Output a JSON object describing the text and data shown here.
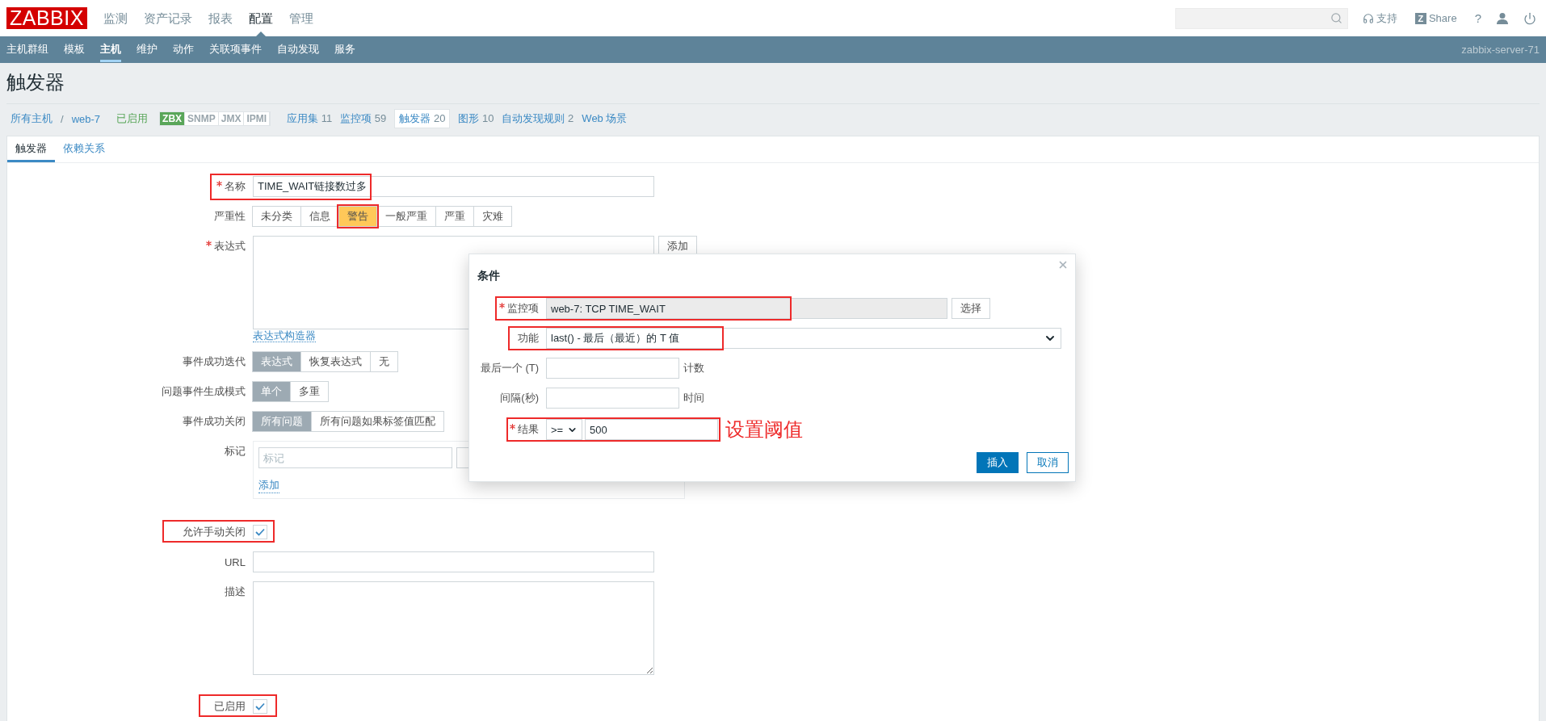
{
  "header": {
    "logo": "ZABBIX",
    "menu": [
      {
        "label": "监测",
        "selected": false
      },
      {
        "label": "资产记录",
        "selected": false
      },
      {
        "label": "报表",
        "selected": false
      },
      {
        "label": "配置",
        "selected": true
      },
      {
        "label": "管理",
        "selected": false
      }
    ],
    "support": "支持",
    "share_letter": "Z",
    "share": "Share",
    "help": "?"
  },
  "subnav": {
    "items": [
      {
        "label": "主机群组",
        "selected": false
      },
      {
        "label": "模板",
        "selected": false
      },
      {
        "label": "主机",
        "selected": true
      },
      {
        "label": "维护",
        "selected": false
      },
      {
        "label": "动作",
        "selected": false
      },
      {
        "label": "关联项事件",
        "selected": false
      },
      {
        "label": "自动发现",
        "selected": false
      },
      {
        "label": "服务",
        "selected": false
      }
    ],
    "server": "zabbix-server-71"
  },
  "page_title": "触发器",
  "breadcrumbs": {
    "items": [
      "所有主机",
      "web-7"
    ],
    "separator": "/",
    "status": "已启用",
    "interfaces": [
      {
        "label": "ZBX",
        "active": true
      },
      {
        "label": "SNMP",
        "active": false
      },
      {
        "label": "JMX",
        "active": false
      },
      {
        "label": "IPMI",
        "active": false
      }
    ],
    "links": [
      {
        "label": "应用集",
        "count": "11",
        "selected": false
      },
      {
        "label": "监控项",
        "count": "59",
        "selected": false
      },
      {
        "label": "触发器",
        "count": "20",
        "selected": true
      },
      {
        "label": "图形",
        "count": "10",
        "selected": false
      },
      {
        "label": "自动发现规则",
        "count": "2",
        "selected": false
      },
      {
        "label": "Web 场景",
        "selected": false
      }
    ]
  },
  "tabs": [
    {
      "label": "触发器",
      "selected": true
    },
    {
      "label": "依赖关系",
      "selected": false
    }
  ],
  "form": {
    "name": {
      "label": "名称",
      "required": true,
      "value": "TIME_WAIT链接数过多",
      "highlighted": true
    },
    "severity": {
      "label": "严重性",
      "options": [
        {
          "label": "未分类",
          "selected": false,
          "highlighted": false
        },
        {
          "label": "信息",
          "selected": false,
          "highlighted": false
        },
        {
          "label": "警告",
          "selected": true,
          "highlighted": true
        },
        {
          "label": "一般严重",
          "selected": false,
          "highlighted": false
        },
        {
          "label": "严重",
          "selected": false,
          "highlighted": false
        },
        {
          "label": "灾难",
          "selected": false,
          "highlighted": false
        }
      ]
    },
    "expression": {
      "label": "表达式",
      "required": true,
      "add_button": "添加",
      "builder_link": "表达式构造器"
    },
    "ok_event": {
      "label": "事件成功迭代",
      "options": [
        {
          "label": "表达式",
          "selected": true
        },
        {
          "label": "恢复表达式",
          "selected": false
        },
        {
          "label": "无",
          "selected": false
        }
      ]
    },
    "mode": {
      "label": "问题事件生成模式",
      "options": [
        {
          "label": "单个",
          "selected": true
        },
        {
          "label": "多重",
          "selected": false
        }
      ]
    },
    "ok_close": {
      "label": "事件成功关闭",
      "options": [
        {
          "label": "所有问题",
          "selected": true
        },
        {
          "label": "所有问题如果标签值匹配",
          "selected": false
        }
      ]
    },
    "tags": {
      "label": "标记",
      "tag_placeholder": "标记",
      "add_link": "添加"
    },
    "manual_close": {
      "label": "允许手动关闭",
      "checked": true,
      "highlighted": true
    },
    "url": {
      "label": "URL"
    },
    "description": {
      "label": "描述"
    },
    "enabled": {
      "label": "已启用",
      "checked": true,
      "highlighted": true
    }
  },
  "dialog": {
    "title": "条件",
    "rows": [
      {
        "kind": "item",
        "label": "监控项",
        "required": true,
        "value": "web-7: TCP TIME_WAIT",
        "button": "选择",
        "highlighted": true
      },
      {
        "kind": "select",
        "label": "功能",
        "value": "last() - 最后（最近）的 T 值",
        "highlighted": true
      },
      {
        "kind": "input",
        "label": "最后一个 (T)",
        "suffix": "计数"
      },
      {
        "kind": "input",
        "label": "间隔(秒)",
        "suffix": "时间"
      },
      {
        "kind": "result",
        "label": "结果",
        "required": true,
        "operator": ">=",
        "value": "500",
        "highlighted": true,
        "annotation": "设置阈值"
      }
    ],
    "buttons": [
      {
        "label": "插入",
        "kind": "primary"
      },
      {
        "label": "取消",
        "kind": "secondary"
      }
    ]
  }
}
